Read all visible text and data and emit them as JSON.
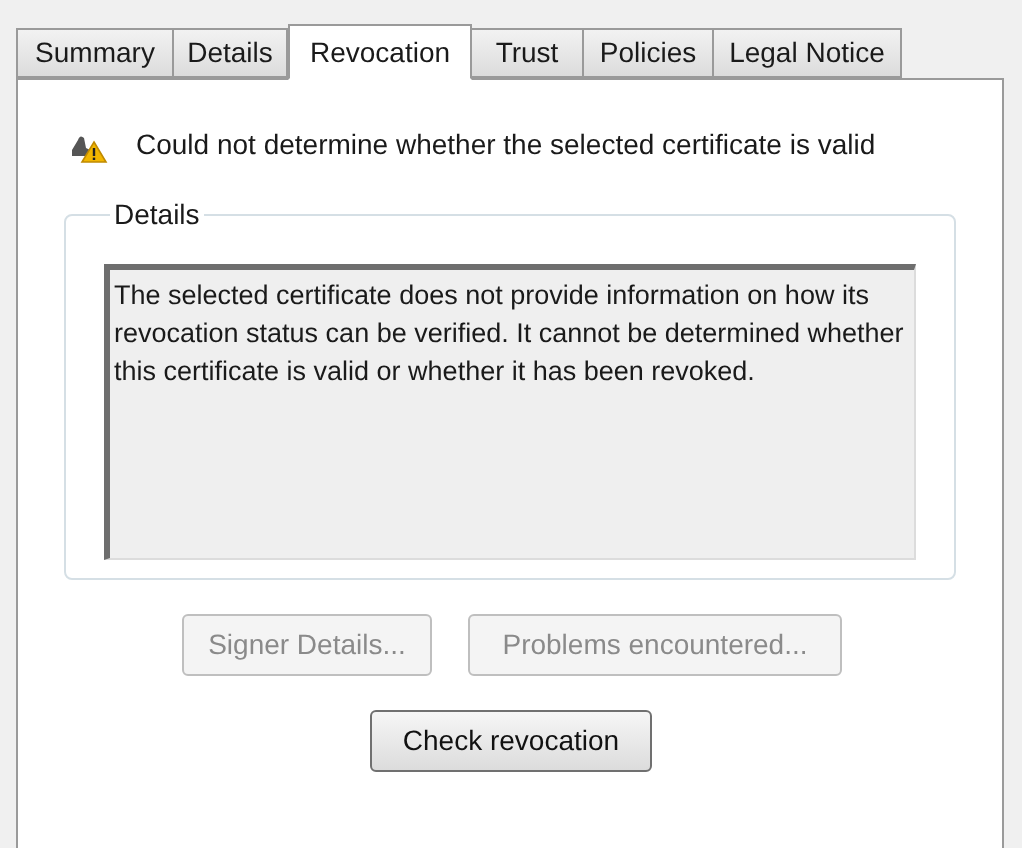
{
  "tabs": [
    {
      "label": "Summary",
      "selected": false
    },
    {
      "label": "Details",
      "selected": false
    },
    {
      "label": "Revocation",
      "selected": true
    },
    {
      "label": "Trust",
      "selected": false
    },
    {
      "label": "Policies",
      "selected": false
    },
    {
      "label": "Legal Notice",
      "selected": false
    }
  ],
  "status_message": "Could not determine whether the selected certificate is valid",
  "details_group": {
    "label": "Details",
    "text": "The selected certificate does not provide information on how its revocation status can be verified. It cannot be determined whether this certificate is valid or whether it has been revoked."
  },
  "buttons": [
    {
      "label": "Signer Details...",
      "disabled": true
    },
    {
      "label": "Problems encountered...",
      "disabled": true
    }
  ],
  "check_button": {
    "label": "Check revocation",
    "disabled": false
  }
}
